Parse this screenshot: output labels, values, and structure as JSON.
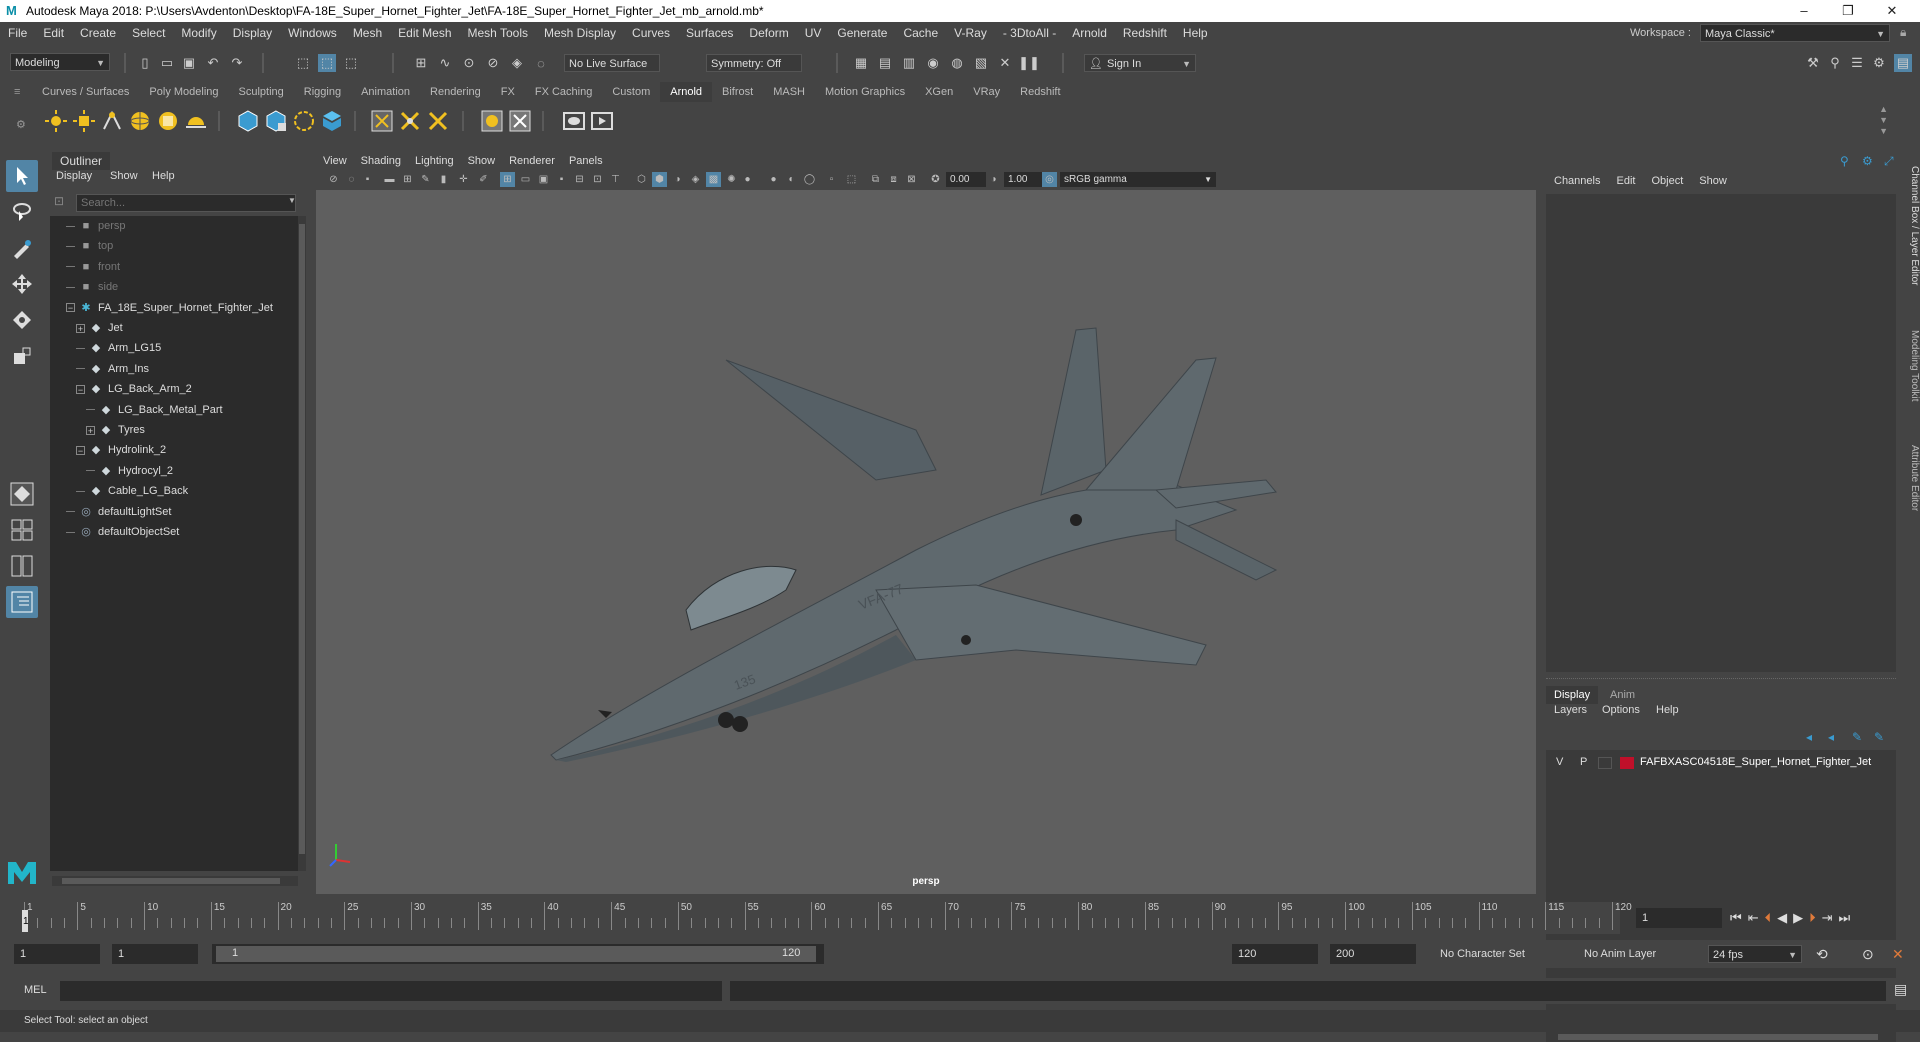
{
  "window": {
    "title": "Autodesk Maya 2018: P:\\Users\\Avdenton\\Desktop\\FA-18E_Super_Hornet_Fighter_Jet\\FA-18E_Super_Hornet_Fighter_Jet_mb_arnold.mb*",
    "minimize": "–",
    "maximize": "❐",
    "close": "✕"
  },
  "menubar": {
    "items": [
      "File",
      "Edit",
      "Create",
      "Select",
      "Modify",
      "Display",
      "Windows",
      "Mesh",
      "Edit Mesh",
      "Mesh Tools",
      "Mesh Display",
      "Curves",
      "Surfaces",
      "Deform",
      "UV",
      "Generate",
      "Cache",
      "V-Ray",
      "- 3DtoAll -",
      "Arnold",
      "Redshift",
      "Help"
    ],
    "workspace_label": "Workspace :",
    "workspace_value": "Maya Classic*"
  },
  "statusline": {
    "mode": "Modeling",
    "live_surface": "No Live Surface",
    "symmetry": "Symmetry: Off",
    "sign_in": "Sign In"
  },
  "shelf": {
    "tabs": [
      "Curves / Surfaces",
      "Poly Modeling",
      "Sculpting",
      "Rigging",
      "Animation",
      "Rendering",
      "FX",
      "FX Caching",
      "Custom",
      "Arnold",
      "Bifrost",
      "MASH",
      "Motion Graphics",
      "XGen",
      "VRay",
      "Redshift"
    ],
    "active_tab": "Arnold"
  },
  "outliner": {
    "title": "Outliner",
    "menu": [
      "Display",
      "Show",
      "Help"
    ],
    "search_placeholder": "Search...",
    "items": [
      {
        "label": "persp",
        "indent": 0,
        "icon": "camera-icon",
        "expander": "",
        "dim": true
      },
      {
        "label": "top",
        "indent": 0,
        "icon": "camera-icon",
        "expander": "",
        "dim": true
      },
      {
        "label": "front",
        "indent": 0,
        "icon": "camera-icon",
        "expander": "",
        "dim": true
      },
      {
        "label": "side",
        "indent": 0,
        "icon": "camera-icon",
        "expander": "",
        "dim": true
      },
      {
        "label": "FA_18E_Super_Hornet_Fighter_Jet",
        "indent": 0,
        "icon": "joint-icon",
        "expander": "−",
        "dim": false
      },
      {
        "label": "Jet",
        "indent": 1,
        "icon": "transform-icon",
        "expander": "+",
        "dim": false
      },
      {
        "label": "Arm_LG15",
        "indent": 1,
        "icon": "transform-icon",
        "expander": "",
        "dim": false
      },
      {
        "label": "Arm_Ins",
        "indent": 1,
        "icon": "transform-icon",
        "expander": "",
        "dim": false
      },
      {
        "label": "LG_Back_Arm_2",
        "indent": 1,
        "icon": "transform-icon",
        "expander": "−",
        "dim": false
      },
      {
        "label": "LG_Back_Metal_Part",
        "indent": 2,
        "icon": "transform-icon",
        "expander": "",
        "dim": false
      },
      {
        "label": "Tyres",
        "indent": 2,
        "icon": "transform-icon",
        "expander": "+",
        "dim": false
      },
      {
        "label": "Hydrolink_2",
        "indent": 1,
        "icon": "transform-icon",
        "expander": "−",
        "dim": false
      },
      {
        "label": "Hydrocyl_2",
        "indent": 2,
        "icon": "transform-icon",
        "expander": "",
        "dim": false
      },
      {
        "label": "Cable_LG_Back",
        "indent": 1,
        "icon": "transform-icon",
        "expander": "",
        "dim": false
      },
      {
        "label": "defaultLightSet",
        "indent": 0,
        "icon": "set-icon",
        "expander": "",
        "dim": false
      },
      {
        "label": "defaultObjectSet",
        "indent": 0,
        "icon": "set-icon",
        "expander": "",
        "dim": false
      }
    ]
  },
  "viewport": {
    "menu": [
      "View",
      "Shading",
      "Lighting",
      "Show",
      "Renderer",
      "Panels"
    ],
    "exposure": "0.00",
    "gamma": "1.00",
    "color_space": "sRGB gamma",
    "camera_label": "persp",
    "model_text_1": "VFA-77",
    "model_text_2": "135"
  },
  "channelbox": {
    "menu": [
      "Channels",
      "Edit",
      "Object",
      "Show"
    ],
    "side_tabs": [
      "Channel Box / Layer Editor",
      "Modeling Toolkit",
      "Attribute Editor"
    ]
  },
  "layereditor": {
    "tabs": [
      "Display",
      "Anim"
    ],
    "active_tab": "Display",
    "menu": [
      "Layers",
      "Options",
      "Help"
    ],
    "layers": [
      {
        "visible": "V",
        "playback": "P",
        "color": "#c0102a",
        "name": "FAFBXASC04518E_Super_Hornet_Fighter_Jet"
      }
    ]
  },
  "timeslider": {
    "ticks": [
      1,
      5,
      10,
      15,
      20,
      25,
      30,
      35,
      40,
      45,
      50,
      55,
      60,
      65,
      70,
      75,
      80,
      85,
      90,
      95,
      100,
      105,
      110,
      115,
      120
    ],
    "current_frame": "1",
    "current_frame_field": "1"
  },
  "rangeslider": {
    "start": "1",
    "playback_start": "1",
    "range_start_label": "1",
    "range_end_label": "120",
    "playback_end": "120",
    "end": "200",
    "character_set": "No Character Set",
    "anim_layer": "No Anim Layer",
    "fps": "24 fps"
  },
  "commandline": {
    "label": "MEL"
  },
  "helpline": {
    "text": "Select Tool: select an object"
  }
}
